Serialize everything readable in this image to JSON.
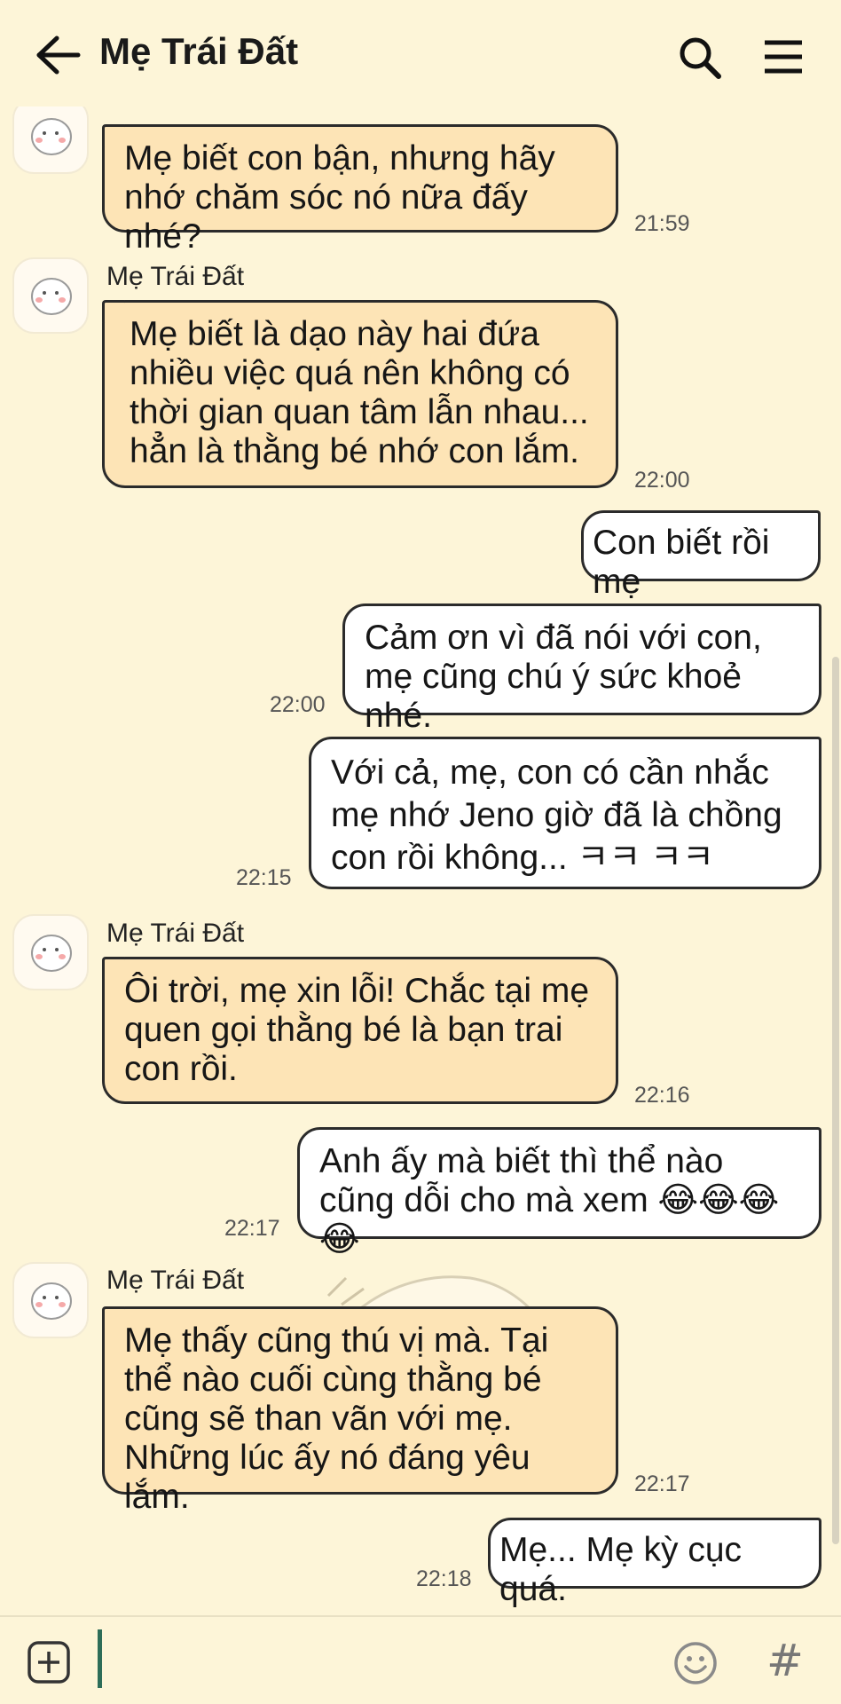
{
  "header": {
    "title": "Mẹ Trái Đất"
  },
  "messages": [
    {
      "sender": "",
      "text": "Mẹ biết con bận, nhưng hãy nhớ chăm sóc nó nữa đấy nhé?",
      "time": "21:59"
    },
    {
      "sender": "Mẹ Trái Đất",
      "text": "Mẹ biết là dạo này hai đứa nhiều việc quá nên không có thời gian quan tâm lẫn nhau... hẳn là thằng bé nhớ con lắm.",
      "time": "22:00"
    },
    {
      "sender": "",
      "text": "Con biết rồi mẹ",
      "time": ""
    },
    {
      "sender": "",
      "text": "Cảm ơn vì đã nói với con, mẹ cũng chú ý sức khoẻ nhé.",
      "time": "22:00"
    },
    {
      "sender": "",
      "text": "Với cả, mẹ, con có cần nhắc mẹ nhớ Jeno giờ đã là chồng con rồi không... ㅋㅋ ㅋㅋ",
      "time": "22:15"
    },
    {
      "sender": "Mẹ Trái Đất",
      "text": "Ôi trời, mẹ xin lỗi! Chắc tại mẹ quen gọi thằng bé là bạn trai con rồi.",
      "time": "22:16"
    },
    {
      "sender": "",
      "text": "Anh ấy mà biết thì thể nào cũng dỗi cho mà xem 😂😂😂😂",
      "time": "22:17"
    },
    {
      "sender": "Mẹ Trái Đất",
      "text": "Mẹ thấy cũng thú vị mà. Tại thể nào cuối cùng thằng bé cũng sẽ than vãn với mẹ. Những lúc ấy nó đáng yêu lắm.",
      "time": "22:17"
    },
    {
      "sender": "",
      "text": "Mẹ... Mẹ kỳ cục quá.",
      "time": "22:18"
    }
  ],
  "colors": {
    "background": "#fdf5d8",
    "incoming_bubble": "#fde4b6",
    "outgoing_bubble": "#ffffff"
  },
  "icons": [
    "back-arrow-icon",
    "search-icon",
    "menu-icon",
    "add-icon",
    "emoji-icon",
    "hash-icon"
  ],
  "input": {
    "hash_label": "#"
  }
}
